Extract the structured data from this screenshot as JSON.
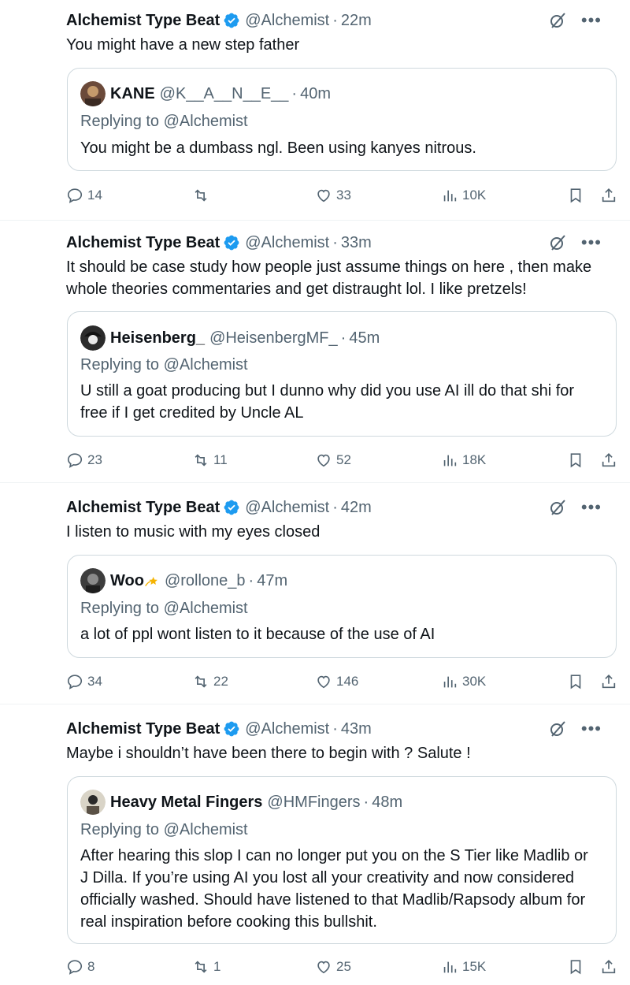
{
  "posts": [
    {
      "author": "Alchemist Type Beat",
      "handle": "@Alchemist",
      "time": "22m",
      "text": "You might have a new step father",
      "quote": {
        "name": "KANE",
        "handle": "@K__A__N__E__",
        "time": "40m",
        "replying": "Replying to @Alchemist",
        "text": "You might be a dumbass ngl. Been using kanyes nitrous."
      },
      "replies": "14",
      "reposts": "",
      "likes": "33",
      "views": "10K"
    },
    {
      "author": "Alchemist Type Beat",
      "handle": "@Alchemist",
      "time": "33m",
      "text": "It should be case study how people just assume things on here , then make whole theories commentaries and get distraught lol.   I like pretzels!",
      "quote": {
        "name": "Heisenberg_",
        "handle": "@HeisenbergMF_",
        "time": "45m",
        "replying": "Replying to @Alchemist",
        "text": "U still a goat producing but I dunno why did you use AI ill do that shi for free if I get credited by Uncle AL"
      },
      "replies": "23",
      "reposts": "11",
      "likes": "52",
      "views": "18K"
    },
    {
      "author": "Alchemist Type Beat",
      "handle": "@Alchemist",
      "time": "42m",
      "text": "I listen to music with my eyes closed",
      "quote": {
        "name": "Woo",
        "handle": "@rollone_b",
        "time": "47m",
        "replying": "Replying to @Alchemist",
        "text": "a lot of ppl wont listen to it because of the use of AI"
      },
      "replies": "34",
      "reposts": "22",
      "likes": "146",
      "views": "30K"
    },
    {
      "author": "Alchemist Type Beat",
      "handle": "@Alchemist",
      "time": "43m",
      "text": "Maybe i shouldn’t have been there to begin with ?  Salute !",
      "quote": {
        "name": "Heavy Metal Fingers",
        "handle": "@HMFingers",
        "time": "48m",
        "replying": "Replying to @Alchemist",
        "text": "After hearing this slop I can no longer put you on the S Tier like Madlib or J Dilla. If you’re using AI you lost all your creativity and now considered officially washed.  Should have listened to that Madlib/Rapsody album for real inspiration before cooking this bullshit."
      },
      "replies": "8",
      "reposts": "1",
      "likes": "25",
      "views": "15K"
    }
  ],
  "icons": {
    "verified": "verified-badge-icon",
    "grok": "grok-icon",
    "more": "more-icon",
    "reply": "reply-icon",
    "repost": "repost-icon",
    "like": "heart-icon",
    "views": "views-icon",
    "bookmark": "bookmark-icon",
    "share": "share-icon"
  },
  "colors": {
    "text": "#0f1419",
    "muted": "#536471",
    "verified": "#1d9bf0",
    "border": "#cfd9de",
    "divider": "#eff3f4"
  }
}
